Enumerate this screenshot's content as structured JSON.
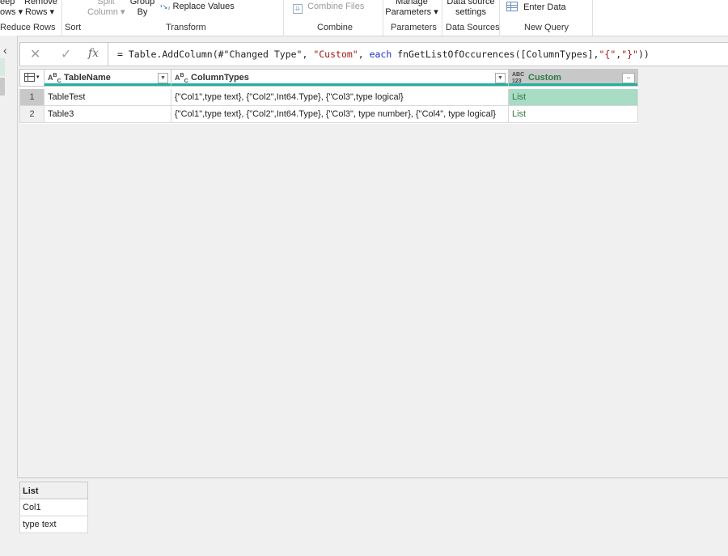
{
  "ribbon": {
    "keep_rows": [
      "eep",
      "ows ▾"
    ],
    "remove_rows": [
      "Remove",
      "Rows ▾"
    ],
    "split_column": [
      "Split",
      "Column ▾"
    ],
    "group_by": [
      "Group",
      "By"
    ],
    "replace_values": "Replace Values",
    "combine_files": "Combine Files",
    "manage_parameters": [
      "Manage",
      "Parameters ▾"
    ],
    "data_source_settings": [
      "Data source",
      "settings"
    ],
    "enter_data": "Enter Data",
    "groups": {
      "reduce_rows": "Reduce Rows",
      "sort": "Sort",
      "transform": "Transform",
      "combine": "Combine",
      "parameters": "Parameters",
      "data_sources": "Data Sources",
      "new_query": "New Query"
    }
  },
  "formula_bar": {
    "cancel_icon": "close-icon",
    "commit_icon": "check-icon",
    "fx_label": "fx",
    "parts": {
      "p1": "= Table.AddColumn(#\"Changed Type\", ",
      "p2": "\"Custom\"",
      "p3": ", ",
      "p4": "each",
      "p5": " fnGetListOfOccurences([ColumnTypes],",
      "p6": "\"{\"",
      "p7": ",",
      "p8": "\"}\"",
      "p9": "))"
    }
  },
  "grid": {
    "columns": [
      {
        "name": "TableName",
        "type_icon": "ABC"
      },
      {
        "name": "ColumnTypes",
        "type_icon": "ABC"
      },
      {
        "name": "Custom",
        "type_icon": "ABC123"
      }
    ],
    "rows": [
      {
        "num": "1",
        "TableName": "TableTest",
        "ColumnTypes": "{\"Col1\",type text}, {\"Col2\",Int64.Type}, {\"Col3\",type logical}",
        "Custom": "List"
      },
      {
        "num": "2",
        "TableName": "Table3",
        "ColumnTypes": "{\"Col1\",type text}, {\"Col2\",Int64.Type}, {\"Col3\", type number}, {\"Col4\", type logical}",
        "Custom": "List"
      }
    ]
  },
  "preview": {
    "header": "List",
    "values": [
      "Col1",
      "type text"
    ]
  },
  "colors": {
    "accent": "#1fb19f",
    "selected_cell": "#a8dcc4",
    "list_text": "#2d7a45"
  }
}
